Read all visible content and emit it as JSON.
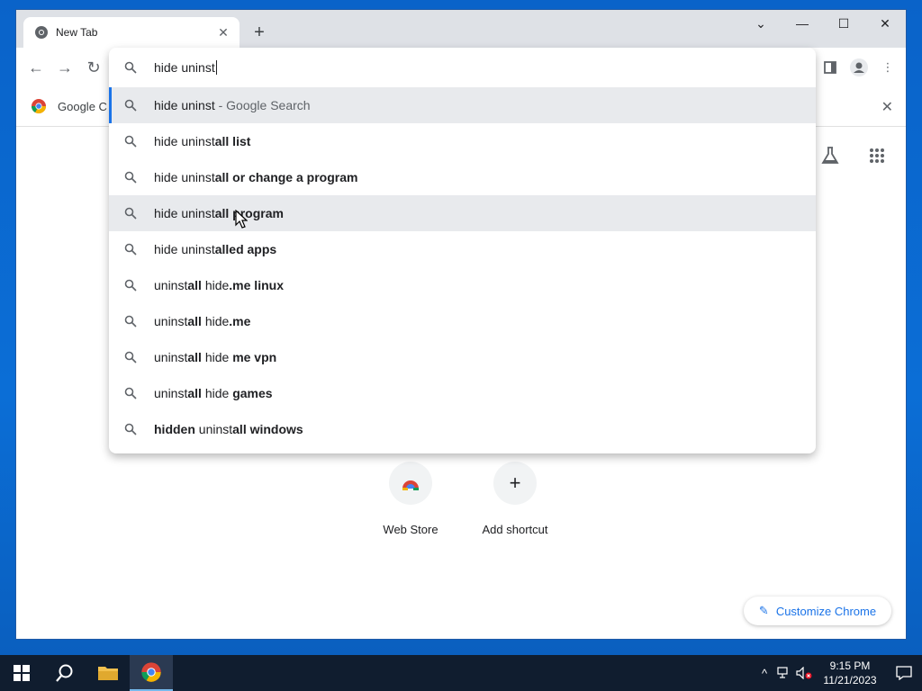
{
  "browser": {
    "tab": {
      "title": "New Tab"
    },
    "bookmark": {
      "label": "Google C"
    }
  },
  "omnibox": {
    "input_value": "hide uninst",
    "suggestions": [
      {
        "plain": "hide uninst",
        "bold": "",
        "suffix": " - Google Search"
      },
      {
        "plain": "hide uninst",
        "bold": "all list"
      },
      {
        "plain": "hide uninst",
        "bold": "all or change a program"
      },
      {
        "plain": "hide uninst",
        "bold": "all program"
      },
      {
        "plain": "hide uninst",
        "bold": "alled apps"
      },
      {
        "parts": [
          "uninst",
          "all",
          " hide",
          ".me linux"
        ]
      },
      {
        "parts": [
          "uninst",
          "all",
          " hide",
          ".me"
        ]
      },
      {
        "parts": [
          "uninst",
          "all",
          " hide ",
          "me vpn"
        ]
      },
      {
        "parts": [
          "uninst",
          "all",
          " hide ",
          "games"
        ]
      },
      {
        "parts": [
          "hidden",
          " uninst",
          "all windows",
          ""
        ]
      }
    ]
  },
  "ntp": {
    "shortcuts": [
      {
        "label": "Web Store"
      },
      {
        "label": "Add shortcut"
      }
    ],
    "customize_label": "Customize Chrome"
  },
  "taskbar": {
    "time": "9:15 PM",
    "date": "11/21/2023"
  },
  "colors": {
    "accent": "#1a73e8",
    "desktop": "#0b6ed6",
    "taskbar": "#101d2f"
  }
}
